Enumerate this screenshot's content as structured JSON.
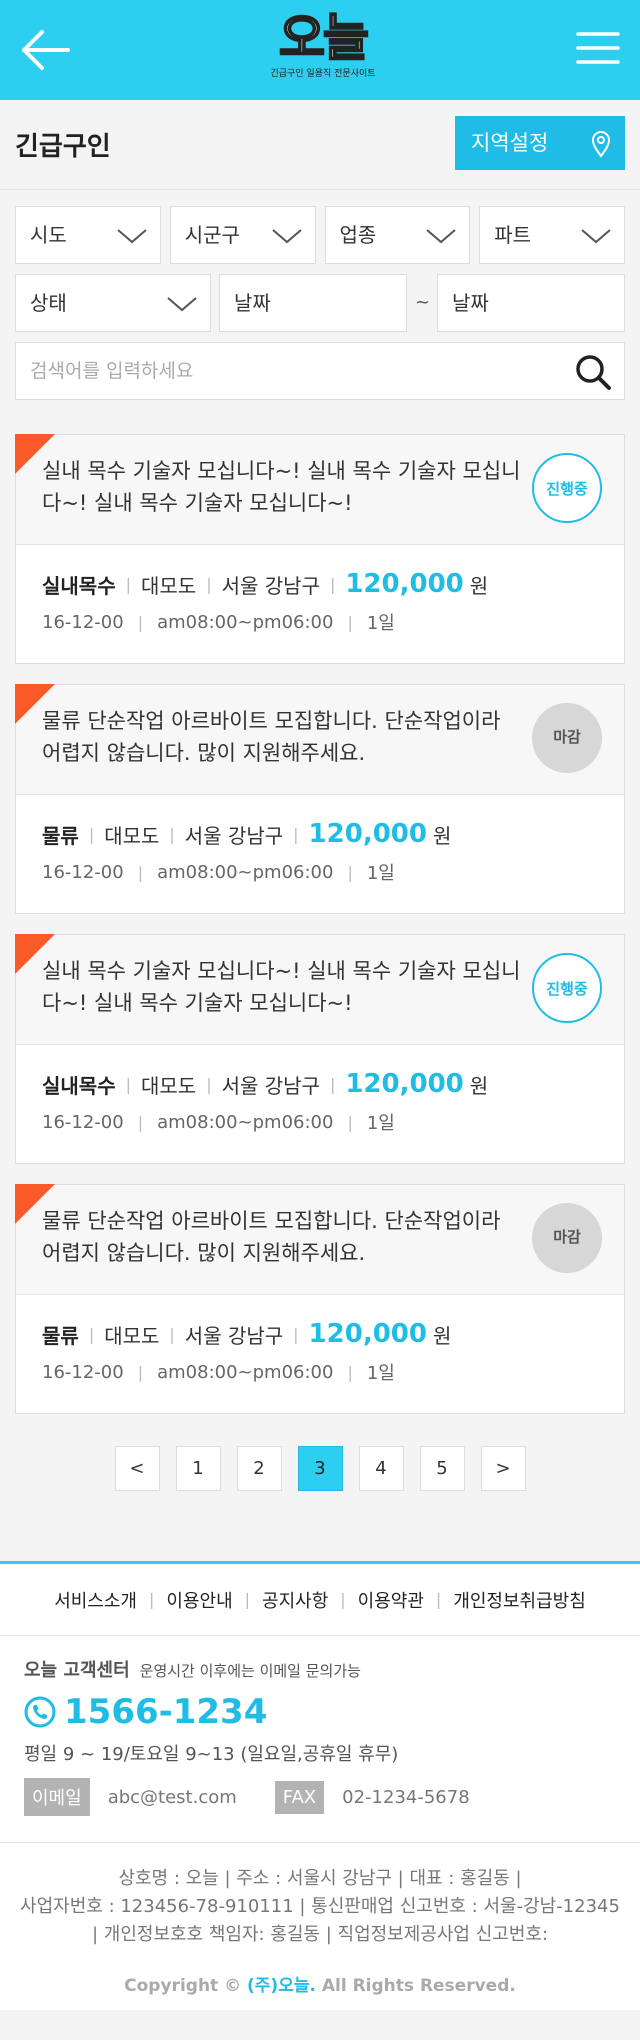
{
  "header": {
    "logo_text": "오늘",
    "logo_sub": "긴급구인 일용직 전문사이트",
    "back_icon": "arrow-left-icon",
    "menu_icon": "hamburger-icon"
  },
  "page": {
    "title": "긴급구인",
    "region_button": "지역설정"
  },
  "filters": {
    "row1": [
      "시도",
      "시군구",
      "업종",
      "파트"
    ],
    "status": "상태",
    "date_from": "날짜",
    "tilde": "~",
    "date_to": "날짜",
    "search_placeholder": "검색어를 입력하세요"
  },
  "jobs": [
    {
      "title": "실내 목수 기술자 모십니다~! 실내 목수 기술자 모십니다~! 실내 목수 기술자 모십니다~!",
      "status": "진행중",
      "category": "실내목수",
      "area": "대모도",
      "location": "서울 강남구",
      "price": "120,000",
      "unit": "원",
      "date": "16-12-00",
      "time": "am08:00~pm06:00",
      "days": "1일"
    },
    {
      "title": "물류 단순작업 아르바이트 모집합니다. 단순작업이라 어렵지 않습니다. 많이 지원해주세요.",
      "status": "마감",
      "category": "물류",
      "area": "대모도",
      "location": "서울 강남구",
      "price": "120,000",
      "unit": "원",
      "date": "16-12-00",
      "time": "am08:00~pm06:00",
      "days": "1일"
    },
    {
      "title": "실내 목수 기술자 모십니다~! 실내 목수 기술자 모십니다~! 실내 목수 기술자 모십니다~!",
      "status": "진행중",
      "category": "실내목수",
      "area": "대모도",
      "location": "서울 강남구",
      "price": "120,000",
      "unit": "원",
      "date": "16-12-00",
      "time": "am08:00~pm06:00",
      "days": "1일"
    },
    {
      "title": "물류 단순작업 아르바이트 모집합니다. 단순작업이라 어렵지 않습니다. 많이 지원해주세요.",
      "status": "마감",
      "category": "물류",
      "area": "대모도",
      "location": "서울 강남구",
      "price": "120,000",
      "unit": "원",
      "date": "16-12-00",
      "time": "am08:00~pm06:00",
      "days": "1일"
    }
  ],
  "pagination": {
    "prev": "<",
    "pages": [
      "1",
      "2",
      "3",
      "4",
      "5"
    ],
    "current": "3",
    "next": ">"
  },
  "footer": {
    "nav": [
      "서비스소개",
      "이용안내",
      "공지사항",
      "이용약관",
      "개인정보취급방침"
    ],
    "cs_title": "오늘 고객센터",
    "cs_note": "운영시간 이후에는 이메일 문의가능",
    "phone": "1566-1234",
    "hours": "평일 9 ~ 19/토요일 9~13 (일요일,공휴일 휴무)",
    "email_label": "이메일",
    "email": "abc@test.com",
    "fax_label": "FAX",
    "fax": "02-1234-5678",
    "biz_line1": "상호명 : 오늘  |  주소 : 서울시 강남구  |  대표 :  홍길동  |",
    "biz_line2": "사업자번호 :  123456-78-910111  | 통신판매업 신고번호 : 서울-강남-12345 | 개인정보호호 책임자: 홍길동 | 직업정보제공사업 신고번호:",
    "copy_prefix": "Copyright ©",
    "copy_brand": "(주)오늘.",
    "copy_suffix": "All Rights Reserved."
  },
  "colors": {
    "accent": "#2ccfef",
    "price": "#1fbde6",
    "corner": "#fa5a28"
  }
}
